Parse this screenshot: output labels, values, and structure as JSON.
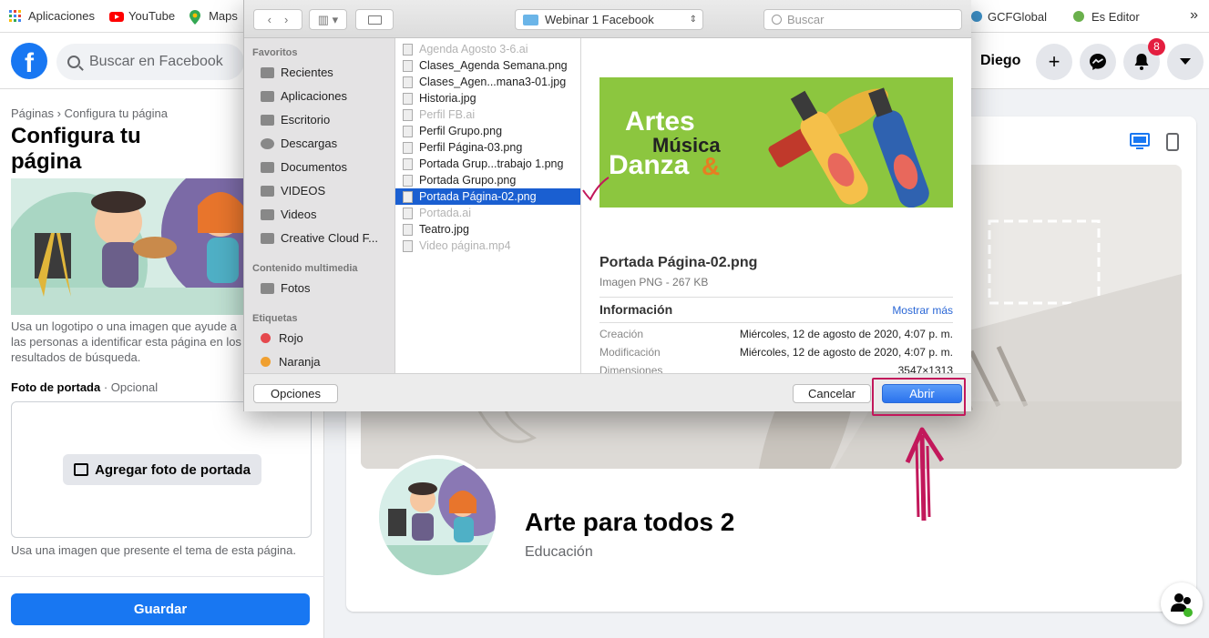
{
  "bookmarks": [
    {
      "label": "Aplicaciones",
      "icon": "apps-grid-icon"
    },
    {
      "label": "YouTube",
      "icon": "youtube-icon"
    },
    {
      "label": "Maps",
      "icon": "maps-icon"
    }
  ],
  "bookmarks_right": [
    {
      "label": "GCFGlobal",
      "icon": "gcf-icon"
    },
    {
      "label": "Es Editor",
      "icon": "editor-icon"
    }
  ],
  "facebook": {
    "search_placeholder": "Buscar en Facebook",
    "user_name": "Diego",
    "notification_count": "8"
  },
  "left_panel": {
    "breadcrumb": "Páginas › Configura tu página",
    "title": "Configura tu página",
    "profile_help": "Usa un logotipo o una imagen que ayude a las personas a identificar esta página en los resultados de búsqueda.",
    "cover_label": "Foto de portada",
    "cover_optional": " · Opcional",
    "add_cover_button": "Agregar foto de portada",
    "cover_help": "Usa una imagen que presente el tema de esta página.",
    "save_button": "Guardar"
  },
  "preview": {
    "page_name": "Arte para todos 2",
    "page_category": "Educación"
  },
  "dialog": {
    "location": "Webinar 1 Facebook",
    "search_placeholder": "Buscar",
    "sidebar": {
      "favorites_header": "Favoritos",
      "favorites": [
        {
          "label": "Recientes",
          "icon": "clock-icon"
        },
        {
          "label": "Aplicaciones",
          "icon": "apps-icon"
        },
        {
          "label": "Escritorio",
          "icon": "desktop-icon"
        },
        {
          "label": "Descargas",
          "icon": "download-icon"
        },
        {
          "label": "Documentos",
          "icon": "document-icon"
        },
        {
          "label": "VIDEOS",
          "icon": "folder-icon"
        },
        {
          "label": "Videos",
          "icon": "film-icon"
        },
        {
          "label": "Creative Cloud F...",
          "icon": "folder-icon"
        }
      ],
      "media_header": "Contenido multimedia",
      "media": [
        {
          "label": "Fotos",
          "icon": "camera-icon"
        }
      ],
      "tags_header": "Etiquetas",
      "tags": [
        {
          "label": "Rojo",
          "color": "#e5484d"
        },
        {
          "label": "Naranja",
          "color": "#f0a030"
        }
      ]
    },
    "files": [
      {
        "name": "Agenda Agosto 3-6.ai",
        "dim": true
      },
      {
        "name": "Clases_Agenda Semana.png",
        "dim": false
      },
      {
        "name": "Clases_Agen...mana3-01.jpg",
        "dim": false
      },
      {
        "name": "Historia.jpg",
        "dim": false
      },
      {
        "name": "Perfil FB.ai",
        "dim": true
      },
      {
        "name": "Perfil Grupo.png",
        "dim": false
      },
      {
        "name": "Perfil Página-03.png",
        "dim": false
      },
      {
        "name": "Portada Grup...trabajo 1.png",
        "dim": false
      },
      {
        "name": "Portada Grupo.png",
        "dim": false
      },
      {
        "name": "Portada Página-02.png",
        "dim": false,
        "selected": true
      },
      {
        "name": "Portada.ai",
        "dim": true
      },
      {
        "name": "Teatro.jpg",
        "dim": false
      },
      {
        "name": "Video página.mp4",
        "dim": true
      }
    ],
    "preview": {
      "banner_text_1": "Artes",
      "banner_text_2": "Música",
      "banner_text_3": "Danza",
      "banner_amp": "&",
      "file_name": "Portada Página-02.png",
      "file_type": "Imagen PNG - 267 KB",
      "info_header": "Información",
      "show_more": "Mostrar más",
      "rows": [
        {
          "key": "Creación",
          "value": "Miércoles, 12 de agosto de 2020, 4:07 p. m."
        },
        {
          "key": "Modificación",
          "value": "Miércoles, 12 de agosto de 2020, 4:07 p. m."
        },
        {
          "key": "Dimensiones",
          "value": "3547×1313"
        }
      ]
    },
    "options_button": "Opciones",
    "cancel_button": "Cancelar",
    "open_button": "Abrir"
  },
  "colors": {
    "fb_blue": "#1877f2",
    "highlight": "#c2185b",
    "selection": "#1a5fd1"
  }
}
